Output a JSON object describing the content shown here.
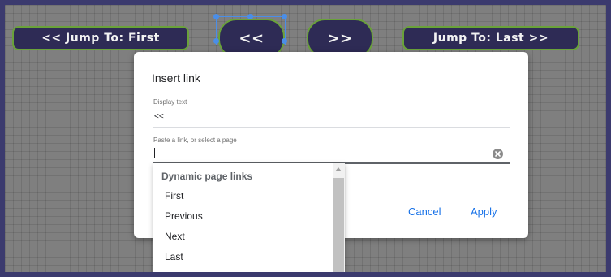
{
  "nav_buttons": {
    "first_label": "<< Jump To: First",
    "prev_label": "<<",
    "next_label": ">>",
    "last_label": "Jump To: Last >>"
  },
  "dialog": {
    "title": "Insert link",
    "display_text_label": "Display text",
    "display_text_value": "<<",
    "link_label": "Paste a link, or select a page",
    "link_value": "",
    "cancel_label": "Cancel",
    "apply_label": "Apply"
  },
  "dropdown": {
    "header": "Dynamic page links",
    "items": [
      "First",
      "Previous",
      "Next",
      "Last"
    ]
  },
  "icons": {
    "clear": "clear-circle-icon",
    "scroll_up": "triangle-up-icon"
  },
  "colors": {
    "accent": "#1a73e8",
    "nav_button_bg": "#2e2b55",
    "nav_button_border": "#6aa23a",
    "selection": "#4a8ee8",
    "frame": "#3b3a6e"
  }
}
